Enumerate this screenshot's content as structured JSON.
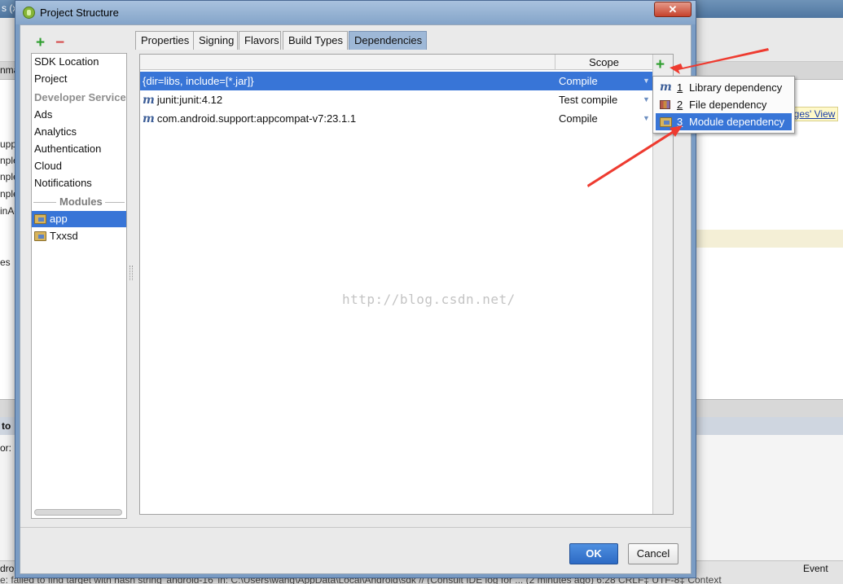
{
  "background": {
    "window_title_fragment": "s (x",
    "tab_fragment": "nma",
    "side_fragments": [
      "upp",
      "nple",
      "nple",
      "nple",
      "inAc",
      "es"
    ],
    "editor_link_text": "ages' View",
    "tool_header_title": "to",
    "console_fragment": "or:",
    "status_left": "dro",
    "status_right": "Event",
    "status_bottom": "e: failed to find target with hash string 'android-16' in: C:\\Users\\wang\\AppData\\Local\\Android\\sdk  // (Consult IDE log for ... (2 minutes ago)    6:28   CRLF‡   UTF-8‡   Context"
  },
  "dialog": {
    "title": "Project Structure",
    "close_label": "✕",
    "left_panel": {
      "add_label": "+",
      "remove_label": "−",
      "items": [
        {
          "label": "SDK Location",
          "kind": "item"
        },
        {
          "label": "Project",
          "kind": "item"
        },
        {
          "label": "Developer Services",
          "kind": "section"
        },
        {
          "label": "Ads",
          "kind": "item"
        },
        {
          "label": "Analytics",
          "kind": "item"
        },
        {
          "label": "Authentication",
          "kind": "item"
        },
        {
          "label": "Cloud",
          "kind": "item"
        },
        {
          "label": "Notifications",
          "kind": "item"
        },
        {
          "label": "Modules",
          "kind": "divider"
        },
        {
          "label": "app",
          "kind": "module",
          "selected": true
        },
        {
          "label": "Txxsd",
          "kind": "module",
          "selected": false
        }
      ]
    },
    "tabs": [
      {
        "label": "Properties",
        "active": false
      },
      {
        "label": "Signing",
        "active": false
      },
      {
        "label": "Flavors",
        "active": false
      },
      {
        "label": "Build Types",
        "active": false
      },
      {
        "label": "Dependencies",
        "active": true
      }
    ],
    "dependencies": {
      "scope_header": "Scope",
      "add_label": "+",
      "rows": [
        {
          "name": "{dir=libs, include=[*.jar]}",
          "scope": "Compile",
          "icon": "none",
          "selected": true
        },
        {
          "name": "junit:junit:4.12",
          "scope": "Test compile",
          "icon": "maven-m-icon",
          "selected": false
        },
        {
          "name": "com.android.support:appcompat-v7:23.1.1",
          "scope": "Compile",
          "icon": "maven-m-icon",
          "selected": false
        }
      ]
    },
    "watermark": "http://blog.csdn.net/",
    "popup_menu": {
      "items": [
        {
          "number": "1",
          "label": "Library dependency",
          "icon": "maven-m-icon",
          "selected": false
        },
        {
          "number": "2",
          "label": "File dependency",
          "icon": "file-icon",
          "selected": false
        },
        {
          "number": "3",
          "label": "Module dependency",
          "icon": "folder-icon",
          "selected": true
        }
      ]
    },
    "buttons": {
      "ok": "OK",
      "cancel": "Cancel"
    }
  },
  "colors": {
    "selection": "#3875d7",
    "annotation_arrow": "#ee3b30",
    "add_green": "#2f9e2f",
    "remove_red": "#d64b4b"
  }
}
